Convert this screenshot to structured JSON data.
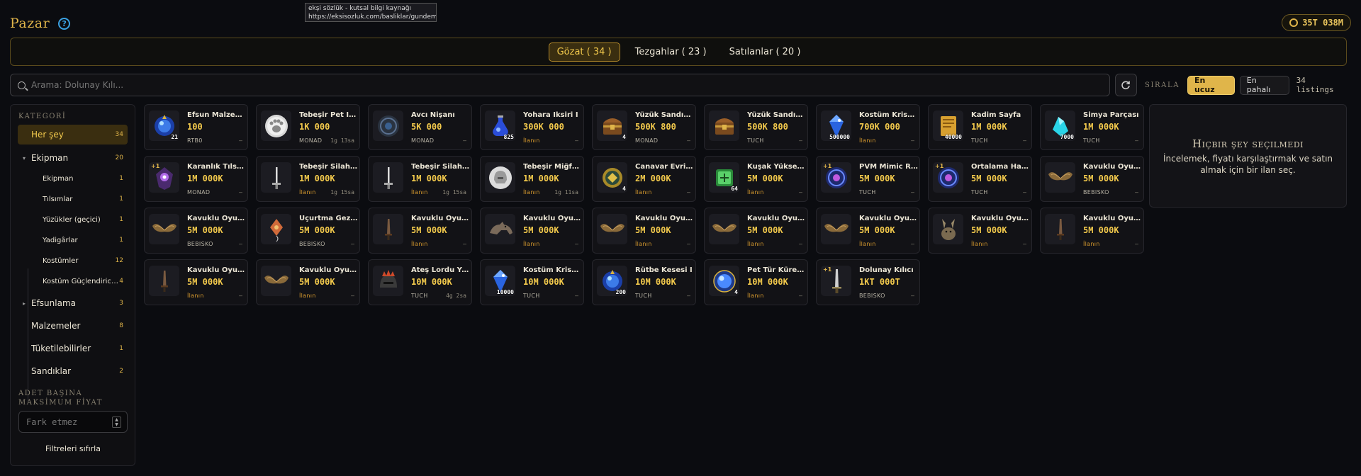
{
  "header": {
    "title": "Pazar",
    "help_icon": "?"
  },
  "tooltip": {
    "line1": "ekşi sözlük - kutsal bilgi kaynağı",
    "line2": "https://eksisozluk.com/basliklar/gundem"
  },
  "balance": {
    "value": "35T 038M"
  },
  "tabs": [
    {
      "label": "Gözat ( 34 )",
      "active": true
    },
    {
      "label": "Tezgahlar ( 23 )",
      "active": false
    },
    {
      "label": "Satılanlar ( 20 )",
      "active": false
    }
  ],
  "search": {
    "placeholder": "Arama: Dolunay Kılı..."
  },
  "sort": {
    "label": "SIRALA",
    "cheapest": "En ucuz",
    "expensive": "En pahalı",
    "count": "34 listings"
  },
  "sidebar": {
    "heading": "KATEGORİ",
    "categories": [
      {
        "label": "Her şey",
        "count": "34"
      },
      {
        "label": "Ekipman",
        "count": "20"
      },
      {
        "label": "Ekipman",
        "count": "1"
      },
      {
        "label": "Tılsımlar",
        "count": "1"
      },
      {
        "label": "Yüzükler (geçici)",
        "count": "1"
      },
      {
        "label": "Yadigârlar",
        "count": "1"
      },
      {
        "label": "Kostümler",
        "count": "12"
      },
      {
        "label": "Kostüm Güçlendirici...",
        "count": "4"
      },
      {
        "label": "Efsunlama",
        "count": "3"
      },
      {
        "label": "Malzemeler",
        "count": "8"
      },
      {
        "label": "Tüketilebilirler",
        "count": "1"
      },
      {
        "label": "Sandıklar",
        "count": "2"
      }
    ],
    "price_heading": "ADET BAŞINA MAKSİMUM FİYAT",
    "price_placeholder": "Fark etmez",
    "reset": "Filtreleri sıfırla"
  },
  "items": [
    {
      "name": "Efsun Malzemesi",
      "price": "100",
      "seller": "RTB0",
      "time": "–",
      "qty": "21",
      "plus": "",
      "icon": "blue-orb"
    },
    {
      "name": "Tebeşir Pet İşareti",
      "price": "1K 000",
      "seller": "MONAD",
      "time": "1g 13sa",
      "qty": "",
      "plus": "",
      "icon": "white-paw"
    },
    {
      "name": "Avcı Nişanı",
      "price": "5K 000",
      "seller": "MONAD",
      "time": "–",
      "qty": "",
      "plus": "",
      "icon": "dark-medallion"
    },
    {
      "name": "Yohara İksiri I",
      "price": "300K 000",
      "seller": "İlanın",
      "time": "–",
      "qty": "825",
      "plus": "",
      "icon": "blue-potion"
    },
    {
      "name": "Yüzük Sandığı I",
      "price": "500K 800",
      "seller": "MONAD",
      "time": "–",
      "qty": "4",
      "plus": "",
      "icon": "chest"
    },
    {
      "name": "Yüzük Sandığı I",
      "price": "500K 800",
      "seller": "TUCH",
      "time": "–",
      "qty": "",
      "plus": "",
      "icon": "chest"
    },
    {
      "name": "Kostüm Kristali I",
      "price": "700K 000",
      "seller": "İlanın",
      "time": "–",
      "qty": "500000",
      "plus": "",
      "icon": "blue-crystal"
    },
    {
      "name": "Kadim Sayfa",
      "price": "1M 000K",
      "seller": "TUCH",
      "time": "–",
      "qty": "40000",
      "plus": "",
      "icon": "gold-page"
    },
    {
      "name": "Simya Parçası",
      "price": "1M 000K",
      "seller": "TUCH",
      "time": "–",
      "qty": "7000",
      "plus": "",
      "icon": "cyan-shard"
    },
    {
      "name": "Karanlık Tılsımı",
      "price": "1M 000K",
      "seller": "MONAD",
      "time": "–",
      "qty": "",
      "plus": "+1",
      "icon": "dark-talisman"
    },
    {
      "name": "Tebeşir Silah İşareti",
      "price": "1M 000K",
      "seller": "İlanın",
      "time": "1g 15sa",
      "qty": "",
      "plus": "",
      "icon": "sword-mark"
    },
    {
      "name": "Tebeşir Silah İşareti",
      "price": "1M 000K",
      "seller": "İlanın",
      "time": "1g 15sa",
      "qty": "",
      "plus": "",
      "icon": "sword-mark"
    },
    {
      "name": "Tebeşir Miğfer İşareti",
      "price": "1M 000K",
      "seller": "İlanın",
      "time": "1g 11sa",
      "qty": "",
      "plus": "",
      "icon": "white-helm"
    },
    {
      "name": "Canavar Evrimi",
      "price": "2M 000K",
      "seller": "İlanın",
      "time": "–",
      "qty": "4",
      "plus": "",
      "icon": "gold-orb"
    },
    {
      "name": "Kuşak Yükseltme",
      "price": "5M 000K",
      "seller": "İlanın",
      "time": "–",
      "qty": "64",
      "plus": "",
      "icon": "green-scroll"
    },
    {
      "name": "PVM Mimic Rünü",
      "price": "5M 000K",
      "seller": "TUCH",
      "time": "–",
      "qty": "",
      "plus": "+1",
      "icon": "purple-rune"
    },
    {
      "name": "Ortalama Hasar",
      "price": "5M 000K",
      "seller": "TUCH",
      "time": "–",
      "qty": "",
      "plus": "+1",
      "icon": "purple-rune"
    },
    {
      "name": "Kavuklu Oyuncak",
      "price": "5M 000K",
      "seller": "BEBISKO",
      "time": "–",
      "qty": "",
      "plus": "",
      "icon": "wings"
    },
    {
      "name": "Kavuklu Oyuncak",
      "price": "5M 000K",
      "seller": "BEBISKO",
      "time": "–",
      "qty": "",
      "plus": "",
      "icon": "wings"
    },
    {
      "name": "Uçurtma Gezgini",
      "price": "5M 000K",
      "seller": "BEBISKO",
      "time": "–",
      "qty": "",
      "plus": "",
      "icon": "kite"
    },
    {
      "name": "Kavuklu Oyuncak",
      "price": "5M 000K",
      "seller": "İlanın",
      "time": "–",
      "qty": "",
      "plus": "",
      "icon": "dagger"
    },
    {
      "name": "Kavuklu Oyuncak",
      "price": "5M 000K",
      "seller": "İlanın",
      "time": "–",
      "qty": "",
      "plus": "",
      "icon": "wolf"
    },
    {
      "name": "Kavuklu Oyuncak",
      "price": "5M 000K",
      "seller": "İlanın",
      "time": "–",
      "qty": "",
      "plus": "",
      "icon": "wings"
    },
    {
      "name": "Kavuklu Oyuncak",
      "price": "5M 000K",
      "seller": "İlanın",
      "time": "–",
      "qty": "",
      "plus": "",
      "icon": "wings"
    },
    {
      "name": "Kavuklu Oyuncak",
      "price": "5M 000K",
      "seller": "İlanın",
      "time": "–",
      "qty": "",
      "plus": "",
      "icon": "wings"
    },
    {
      "name": "Kavuklu Oyuncak",
      "price": "5M 000K",
      "seller": "İlanın",
      "time": "–",
      "qty": "",
      "plus": "",
      "icon": "rabbit"
    },
    {
      "name": "Kavuklu Oyuncak",
      "price": "5M 000K",
      "seller": "İlanın",
      "time": "–",
      "qty": "",
      "plus": "",
      "icon": "dagger"
    },
    {
      "name": "Kavuklu Oyuncak",
      "price": "5M 000K",
      "seller": "İlanın",
      "time": "–",
      "qty": "",
      "plus": "",
      "icon": "dagger"
    },
    {
      "name": "Kavuklu Oyuncak",
      "price": "5M 000K",
      "seller": "İlanın",
      "time": "–",
      "qty": "",
      "plus": "",
      "icon": "wings"
    },
    {
      "name": "Ateş Lordu Yüzüğü",
      "price": "10M 000K",
      "seller": "TUCH",
      "time": "4g 2sa",
      "qty": "",
      "plus": "",
      "icon": "fire-helm"
    },
    {
      "name": "Kostüm Kristali I",
      "price": "10M 000K",
      "seller": "TUCH",
      "time": "–",
      "qty": "10000",
      "plus": "",
      "icon": "blue-crystal"
    },
    {
      "name": "Rütbe Kesesi I",
      "price": "10M 000K",
      "seller": "TUCH",
      "time": "–",
      "qty": "200",
      "plus": "",
      "icon": "blue-orb"
    },
    {
      "name": "Pet Tür Küresi I",
      "price": "10M 000K",
      "seller": "İlanın",
      "time": "–",
      "qty": "4",
      "plus": "",
      "icon": "blue-sphere"
    },
    {
      "name": "Dolunay Kılıcı",
      "price": "1KT 000T",
      "seller": "BEBISKO",
      "time": "–",
      "qty": "",
      "plus": "+1",
      "icon": "sword"
    }
  ],
  "detail": {
    "title": "Hiçbir şey seçilmedi",
    "desc": "İncelemek, fiyatı karşılaştırmak ve satın almak için bir ilan seç."
  }
}
